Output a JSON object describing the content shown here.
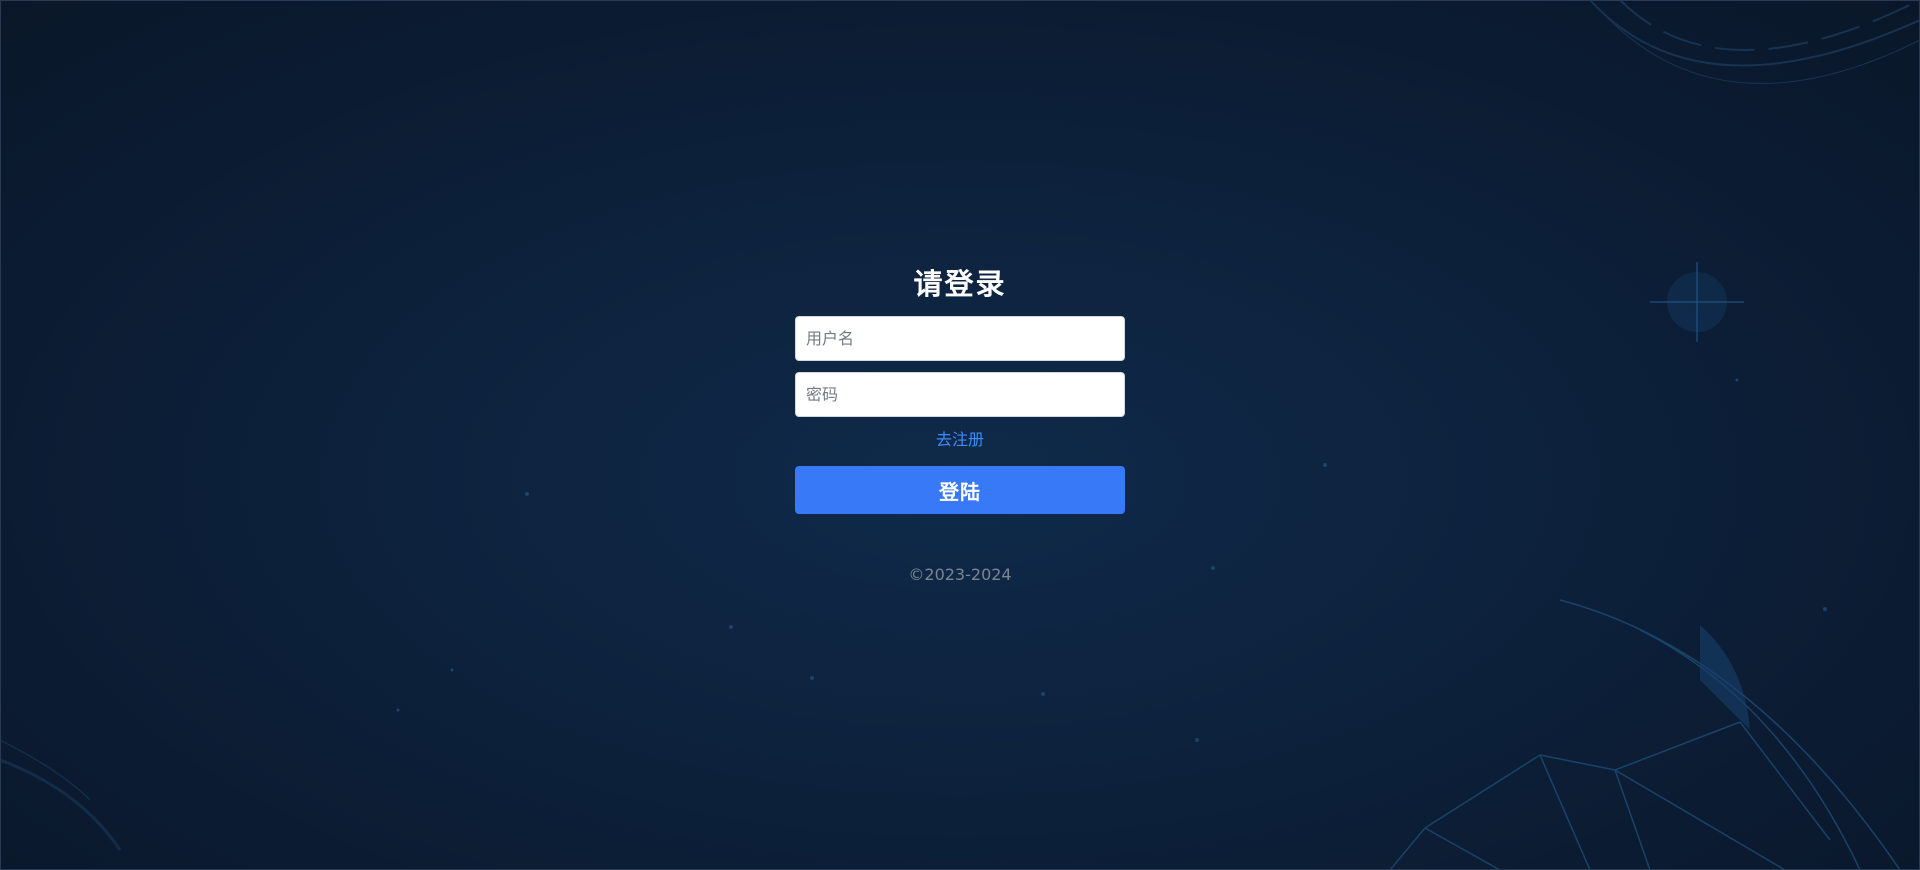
{
  "login": {
    "title": "请登录",
    "username_placeholder": "用户名",
    "password_placeholder": "密码",
    "register_link": "去注册",
    "submit_label": "登陆"
  },
  "footer": {
    "copyright": "©2023-2024"
  },
  "theme": {
    "accent": "#3779f7",
    "link": "#3f8cff",
    "background": "#0d223d"
  }
}
